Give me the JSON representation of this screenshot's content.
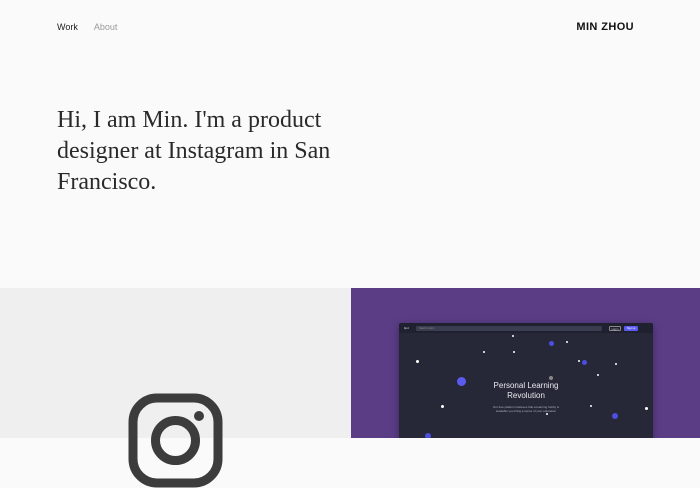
{
  "nav": {
    "work": "Work",
    "about": "About"
  },
  "brand": "MIN ZHOU",
  "hero": {
    "text": "Hi, I am Min. I'm a product designer at Instagram in San Francisco."
  },
  "projects": [
    {
      "icon": "instagram-icon",
      "background": "#efefef"
    },
    {
      "background": "#5b3d86",
      "preview": {
        "logo": "ltpd",
        "search_placeholder": "Search topics",
        "login_label": "Log in",
        "signup_label": "Sign up",
        "headline_line1": "Personal Learning",
        "headline_line2": "Revolution",
        "subtext": "Our free platform believes that a learning hobby is available you bring a sense of your education"
      }
    }
  ],
  "colors": {
    "accent_blue": "#5b5bf0",
    "purple": "#5b3d86",
    "screen_dark": "#262838"
  }
}
